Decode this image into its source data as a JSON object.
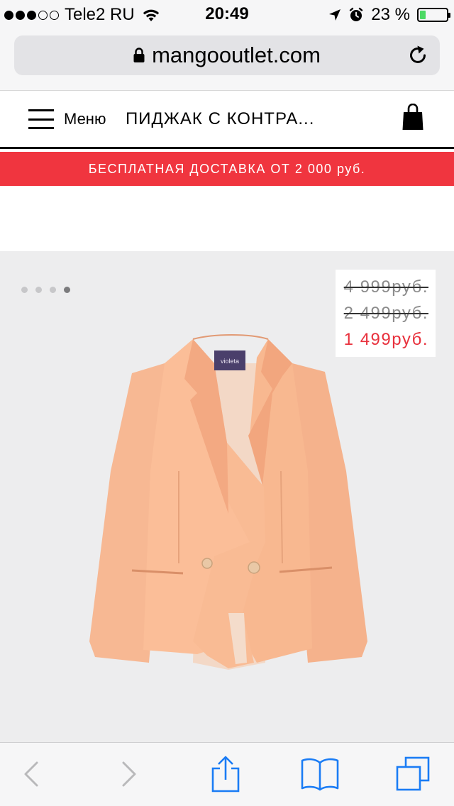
{
  "status_bar": {
    "signal_bars_filled": 3,
    "signal_bars_total": 5,
    "carrier": "Tele2 RU",
    "time": "20:49",
    "battery_percent": "23 %",
    "battery_level": 0.23,
    "battery_color": "#4cd964"
  },
  "browser": {
    "url": "mangooutlet.com",
    "lock_icon": "lock-icon",
    "reload_icon": "reload-icon"
  },
  "header": {
    "menu_label": "Меню",
    "product_title": "ПИДЖАК С КОНТРА...",
    "bag_icon": "shopping-bag-icon"
  },
  "promo": {
    "text": "БЕСПЛАТНАЯ ДОСТАВКА ОТ 2 000 руб.",
    "background": "#f0353f"
  },
  "gallery": {
    "image_count": 4,
    "active_image": 4,
    "label_text": "violeta",
    "prices": {
      "original": "4 999",
      "previous": "2 499",
      "current": "1 499",
      "currency": "руб.",
      "current_color": "#e8303c"
    }
  },
  "toolbar": {
    "back_icon": "chevron-left-icon",
    "forward_icon": "chevron-right-icon",
    "share_icon": "share-icon",
    "bookmarks_icon": "book-icon",
    "tabs_icon": "tabs-icon",
    "accent": "#1a7cf5"
  }
}
